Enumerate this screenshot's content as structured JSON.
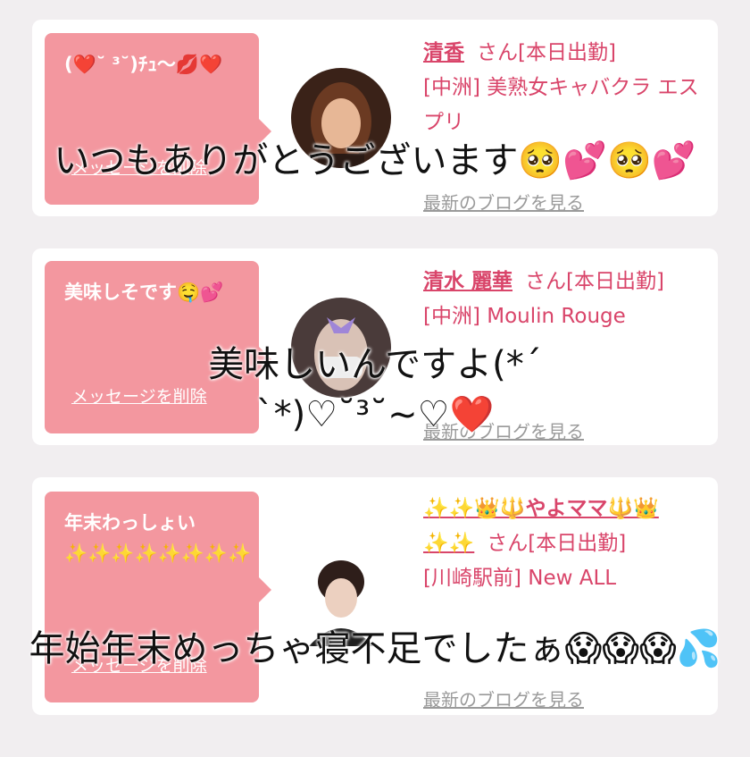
{
  "cards": [
    {
      "message": "(❤️˘ ³˘)ﾁｭ〜💋❤️",
      "delete_label": "メッセージを削除",
      "name": "清香",
      "suffix": "さん[本日出勤]",
      "shop": "[中洲] 美熟女キャバクラ エスプリ",
      "blog_label": "最新のブログを見る"
    },
    {
      "message": "美味しそです🤤💕",
      "delete_label": "メッセージを削除",
      "name": "清水 麗華",
      "suffix": "さん[本日出勤]",
      "shop": "[中洲] Moulin Rouge",
      "blog_label": "最新のブログを見る"
    },
    {
      "message": "年末わっしょい✨✨✨✨✨✨✨✨",
      "delete_label": "メッセージを削除",
      "name": "✨✨👑🔱やよママ🔱👑✨✨",
      "suffix": "さん[本日出勤]",
      "shop": "[川崎駅前] New ALL",
      "blog_label": "最新のブログを見る"
    }
  ],
  "overlays": [
    "いつもありがとうございます🥺💕🥺💕",
    "美味しいんですよ(*ˊ ˋ*)♡˘³˘~♡❤️",
    "年始年末めっちゃ寝不足でしたぁ😱😱😱💦"
  ],
  "colors": {
    "background": "#f1eef0",
    "bubble": "#f3979f",
    "accent": "#d9456a"
  }
}
